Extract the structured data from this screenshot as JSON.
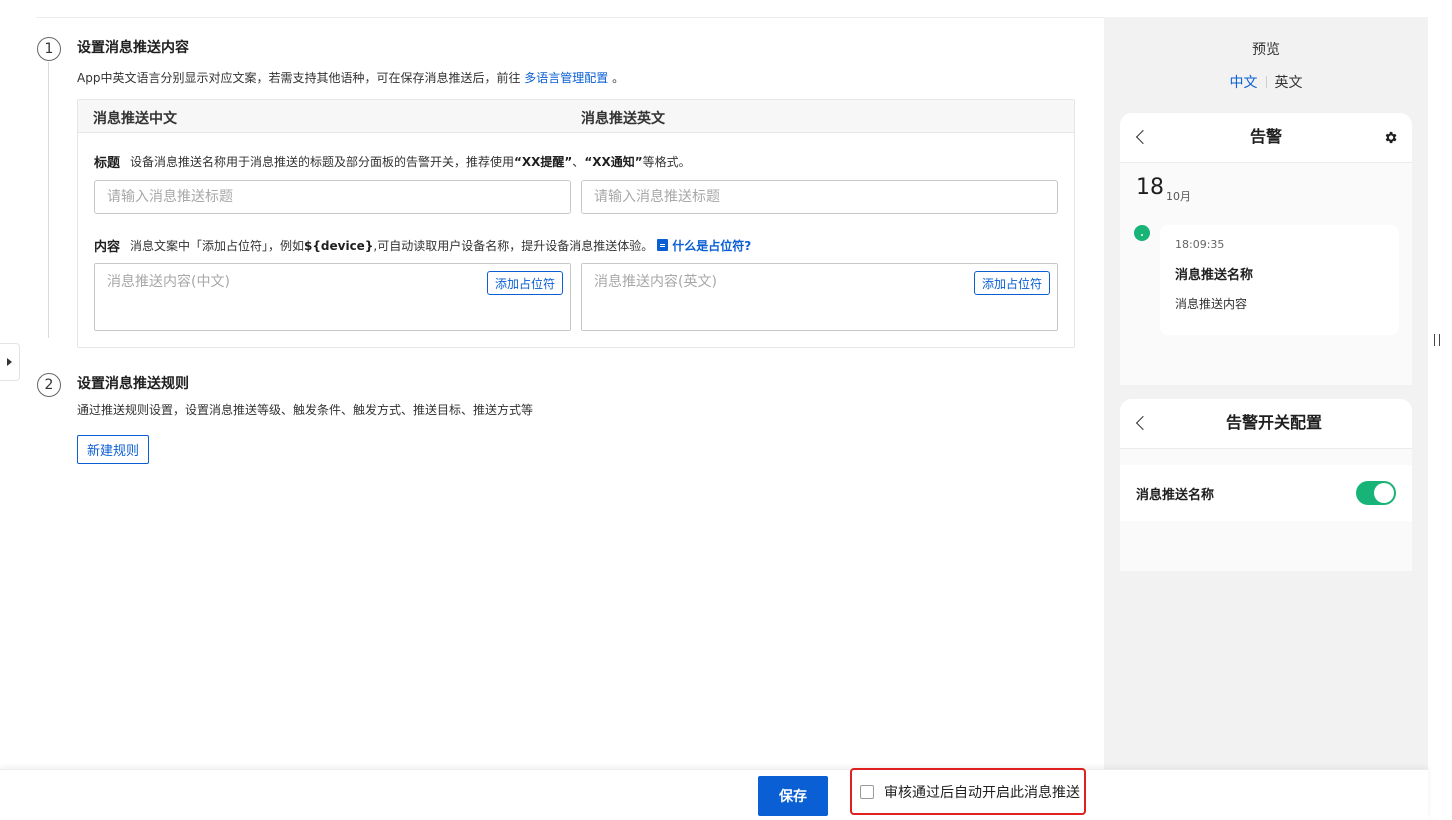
{
  "step1": {
    "number": "1",
    "title": "设置消息推送内容",
    "desc_prefix": "App中英文语言分别显示对应文案，若需支持其他语种，可在保存消息推送后，前往",
    "desc_link": "多语言管理配置",
    "desc_suffix": "。",
    "card": {
      "col_cn": "消息推送中文",
      "col_en": "消息推送英文",
      "title_label": "标题",
      "title_hint_prefix": "设备消息推送名称用于消息推送的标题及部分面板的告警开关，推荐使用",
      "title_hint_ex1": "“XX提醒”",
      "title_hint_sep": "、",
      "title_hint_ex2": "“XX通知”",
      "title_hint_suffix": "等格式。",
      "title_cn_placeholder": "请输入消息推送标题",
      "title_en_placeholder": "请输入消息推送标题",
      "content_label": "内容",
      "content_hint_prefix": "消息文案中「添加占位符」，例如",
      "content_hint_code": "${device}",
      "content_hint_suffix": ",可自动读取用户设备名称，提升设备消息推送体验。",
      "content_hint_link": "什么是占位符?",
      "content_cn_placeholder": "消息推送内容(中文)",
      "content_en_placeholder": "消息推送内容(英文)",
      "add_placeholder_label": "添加占位符"
    }
  },
  "step2": {
    "number": "2",
    "title": "设置消息推送规则",
    "desc": "通过推送规则设置，设置消息推送等级、触发条件、触发方式、推送目标、推送方式等",
    "new_rule_label": "新建规则"
  },
  "preview": {
    "title": "预览",
    "lang_tabs": [
      "中文",
      "英文"
    ],
    "active_lang": "中文",
    "alert_screen": {
      "title": "告警",
      "day": "18",
      "month": "10月",
      "time": "18:09:35",
      "message_name": "消息推送名称",
      "message_content": "消息推送内容"
    },
    "switch_screen": {
      "title": "告警开关配置",
      "item_label": "消息推送名称",
      "toggle_on": true
    }
  },
  "bottom": {
    "save_label": "保存",
    "auto_enable_label": "审核通过后自动开启此消息推送",
    "auto_enable_checked": false
  },
  "colors": {
    "primary": "#0a5fd4",
    "success": "#18b376",
    "highlight": "#e02020"
  }
}
